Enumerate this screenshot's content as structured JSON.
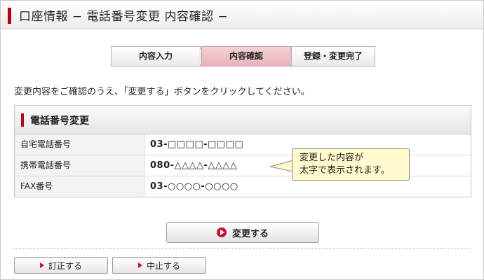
{
  "header": {
    "title": "口座情報 − 電話番号変更 内容確認 −"
  },
  "steps": [
    {
      "label": "内容入力",
      "active": false
    },
    {
      "label": "内容確認",
      "active": true
    },
    {
      "label": "登録・変更完了",
      "active": false
    }
  ],
  "instruction": "変更内容をご確認のうえ、「変更する」ボタンをクリックしてください。",
  "section": {
    "title": "電話番号変更",
    "rows": [
      {
        "label": "自宅電話番号",
        "value": "03-□□□□-□□□□"
      },
      {
        "label": "携帯電話番号",
        "value": "080-△△△△-△△△△"
      },
      {
        "label": "FAX番号",
        "value": "03-○○○○-○○○○"
      }
    ]
  },
  "callout": {
    "line1": "変更した内容が",
    "line2": "太字で表示されます。"
  },
  "buttons": {
    "submit": "変更する",
    "correct": "訂正する",
    "cancel": "中止する"
  },
  "colors": {
    "accent": "#b3001b",
    "active_step": "#e7b3b9",
    "callout_bg": "#fff9cc"
  },
  "icons": {
    "submit": "play-circle-icon",
    "sub": "triangle-right-icon"
  }
}
